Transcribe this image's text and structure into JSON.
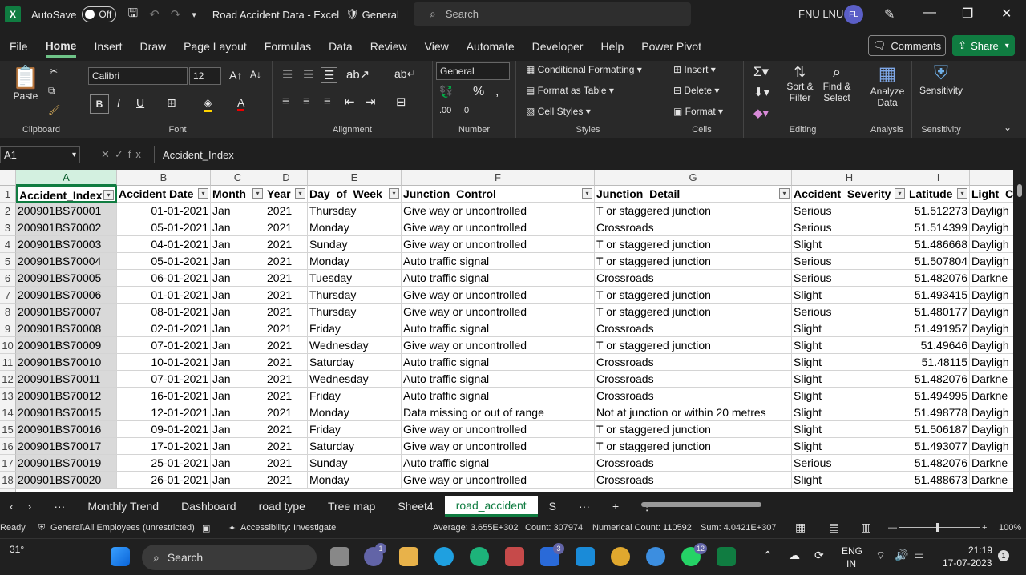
{
  "titlebar": {
    "autosave_label": "AutoSave",
    "autosave_state": "Off",
    "doc_title": "Road Accident Data  -  Excel",
    "sensitivity": "General",
    "search_placeholder": "Search",
    "user_name": "FNU LNU",
    "user_initials": "FL"
  },
  "menu": {
    "tabs": [
      "File",
      "Home",
      "Insert",
      "Draw",
      "Page Layout",
      "Formulas",
      "Data",
      "Review",
      "View",
      "Automate",
      "Developer",
      "Help",
      "Power Pivot"
    ],
    "comments": "Comments",
    "share": "Share"
  },
  "ribbon": {
    "clipboard": {
      "label": "Clipboard",
      "paste": "Paste"
    },
    "font": {
      "label": "Font",
      "name": "Calibri",
      "size": "12"
    },
    "alignment": {
      "label": "Alignment"
    },
    "number": {
      "label": "Number",
      "format": "General"
    },
    "styles": {
      "label": "Styles",
      "cond": "Conditional Formatting",
      "table": "Format as Table",
      "cell": "Cell Styles"
    },
    "cells": {
      "label": "Cells",
      "insert": "Insert",
      "delete": "Delete",
      "format": "Format"
    },
    "editing": {
      "label": "Editing",
      "sort": "Sort &",
      "sort2": "Filter",
      "find": "Find &",
      "find2": "Select"
    },
    "analysis": {
      "label": "Analysis",
      "analyze": "Analyze",
      "analyze2": "Data"
    },
    "sensitivity": {
      "label": "Sensitivity",
      "btn": "Sensitivity"
    }
  },
  "formula": {
    "namebox": "A1",
    "content": "Accident_Index"
  },
  "columns": [
    "A",
    "B",
    "C",
    "D",
    "E",
    "F",
    "G",
    "H",
    "I"
  ],
  "headers": [
    "Accident_Index",
    "Accident Date",
    "Month",
    "Year",
    "Day_of_Week",
    "Junction_Control",
    "Junction_Detail",
    "Accident_Severity",
    "Latitude",
    "Light_C"
  ],
  "rows": [
    [
      "200901BS70001",
      "01-01-2021",
      "Jan",
      "2021",
      "Thursday",
      "Give way or uncontrolled",
      "T or staggered junction",
      "Serious",
      "51.512273",
      "Dayligh"
    ],
    [
      "200901BS70002",
      "05-01-2021",
      "Jan",
      "2021",
      "Monday",
      "Give way or uncontrolled",
      "Crossroads",
      "Serious",
      "51.514399",
      "Dayligh"
    ],
    [
      "200901BS70003",
      "04-01-2021",
      "Jan",
      "2021",
      "Sunday",
      "Give way or uncontrolled",
      "T or staggered junction",
      "Slight",
      "51.486668",
      "Dayligh"
    ],
    [
      "200901BS70004",
      "05-01-2021",
      "Jan",
      "2021",
      "Monday",
      "Auto traffic signal",
      "T or staggered junction",
      "Serious",
      "51.507804",
      "Dayligh"
    ],
    [
      "200901BS70005",
      "06-01-2021",
      "Jan",
      "2021",
      "Tuesday",
      "Auto traffic signal",
      "Crossroads",
      "Serious",
      "51.482076",
      "Darkne"
    ],
    [
      "200901BS70006",
      "01-01-2021",
      "Jan",
      "2021",
      "Thursday",
      "Give way or uncontrolled",
      "T or staggered junction",
      "Slight",
      "51.493415",
      "Dayligh"
    ],
    [
      "200901BS70007",
      "08-01-2021",
      "Jan",
      "2021",
      "Thursday",
      "Give way or uncontrolled",
      "T or staggered junction",
      "Serious",
      "51.480177",
      "Dayligh"
    ],
    [
      "200901BS70008",
      "02-01-2021",
      "Jan",
      "2021",
      "Friday",
      "Auto traffic signal",
      "Crossroads",
      "Slight",
      "51.491957",
      "Dayligh"
    ],
    [
      "200901BS70009",
      "07-01-2021",
      "Jan",
      "2021",
      "Wednesday",
      "Give way or uncontrolled",
      "T or staggered junction",
      "Slight",
      "51.49646",
      "Dayligh"
    ],
    [
      "200901BS70010",
      "10-01-2021",
      "Jan",
      "2021",
      "Saturday",
      "Auto traffic signal",
      "Crossroads",
      "Slight",
      "51.48115",
      "Dayligh"
    ],
    [
      "200901BS70011",
      "07-01-2021",
      "Jan",
      "2021",
      "Wednesday",
      "Auto traffic signal",
      "Crossroads",
      "Slight",
      "51.482076",
      "Darkne"
    ],
    [
      "200901BS70012",
      "16-01-2021",
      "Jan",
      "2021",
      "Friday",
      "Auto traffic signal",
      "Crossroads",
      "Slight",
      "51.494995",
      "Darkne"
    ],
    [
      "200901BS70015",
      "12-01-2021",
      "Jan",
      "2021",
      "Monday",
      "Data missing or out of range",
      "Not at junction or within 20 metres",
      "Slight",
      "51.498778",
      "Dayligh"
    ],
    [
      "200901BS70016",
      "09-01-2021",
      "Jan",
      "2021",
      "Friday",
      "Give way or uncontrolled",
      "T or staggered junction",
      "Slight",
      "51.506187",
      "Dayligh"
    ],
    [
      "200901BS70017",
      "17-01-2021",
      "Jan",
      "2021",
      "Saturday",
      "Give way or uncontrolled",
      "T or staggered junction",
      "Slight",
      "51.493077",
      "Dayligh"
    ],
    [
      "200901BS70019",
      "25-01-2021",
      "Jan",
      "2021",
      "Sunday",
      "Auto traffic signal",
      "Crossroads",
      "Serious",
      "51.482076",
      "Darkne"
    ],
    [
      "200901BS70020",
      "26-01-2021",
      "Jan",
      "2021",
      "Monday",
      "Give way or uncontrolled",
      "Crossroads",
      "Slight",
      "51.488673",
      "Darkne"
    ]
  ],
  "sheets": [
    "Monthly Trend",
    "Dashboard",
    "road type",
    "Tree map",
    "Sheet4",
    "road_accident",
    "S"
  ],
  "active_sheet": "road_accident",
  "status": {
    "ready": "Ready",
    "label": "General\\All Employees (unrestricted)",
    "accessibility": "Accessibility: Investigate",
    "average": "Average: 3.655E+302",
    "count": "Count: 307974",
    "numcount": "Numerical Count: 110592",
    "sum": "Sum: 4.0421E+307",
    "zoom": "100%"
  },
  "taskbar": {
    "weather": "31°",
    "search": "Search",
    "lang1": "ENG",
    "lang2": "IN",
    "time": "21:19",
    "date": "17-07-2023",
    "badge_teams": "1",
    "badge_todo": "3",
    "badge_whatsapp": "12",
    "badge_notif": "1"
  }
}
